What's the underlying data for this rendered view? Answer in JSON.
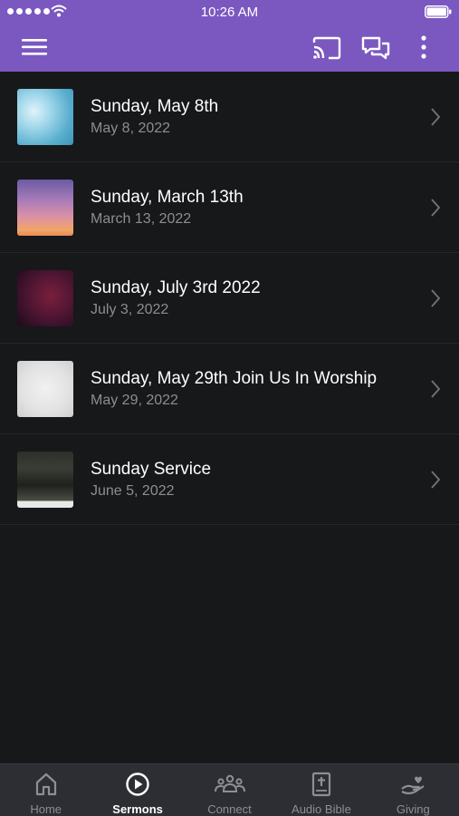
{
  "status_bar": {
    "time": "10:26 AM"
  },
  "app_bar": {
    "background": "#7b58c0",
    "icons": [
      "hamburger-menu-icon",
      "cast-icon",
      "chat-icon",
      "more-vertical-icon"
    ]
  },
  "sermons": [
    {
      "title": "Sunday, May 8th",
      "date": "May 8, 2022"
    },
    {
      "title": "Sunday, March 13th",
      "date": "March 13, 2022"
    },
    {
      "title": "Sunday, July 3rd 2022",
      "date": "July 3, 2022"
    },
    {
      "title": "Sunday, May 29th Join Us In Worship",
      "date": "May 29, 2022"
    },
    {
      "title": "Sunday Service",
      "date": "June 5, 2022"
    }
  ],
  "tabs": [
    {
      "label": "Home",
      "icon": "home-icon",
      "active": false
    },
    {
      "label": "Sermons",
      "icon": "play-circle-icon",
      "active": true
    },
    {
      "label": "Connect",
      "icon": "people-icon",
      "active": false
    },
    {
      "label": "Audio Bible",
      "icon": "bible-icon",
      "active": false
    },
    {
      "label": "Giving",
      "icon": "giving-hand-icon",
      "active": false
    }
  ]
}
